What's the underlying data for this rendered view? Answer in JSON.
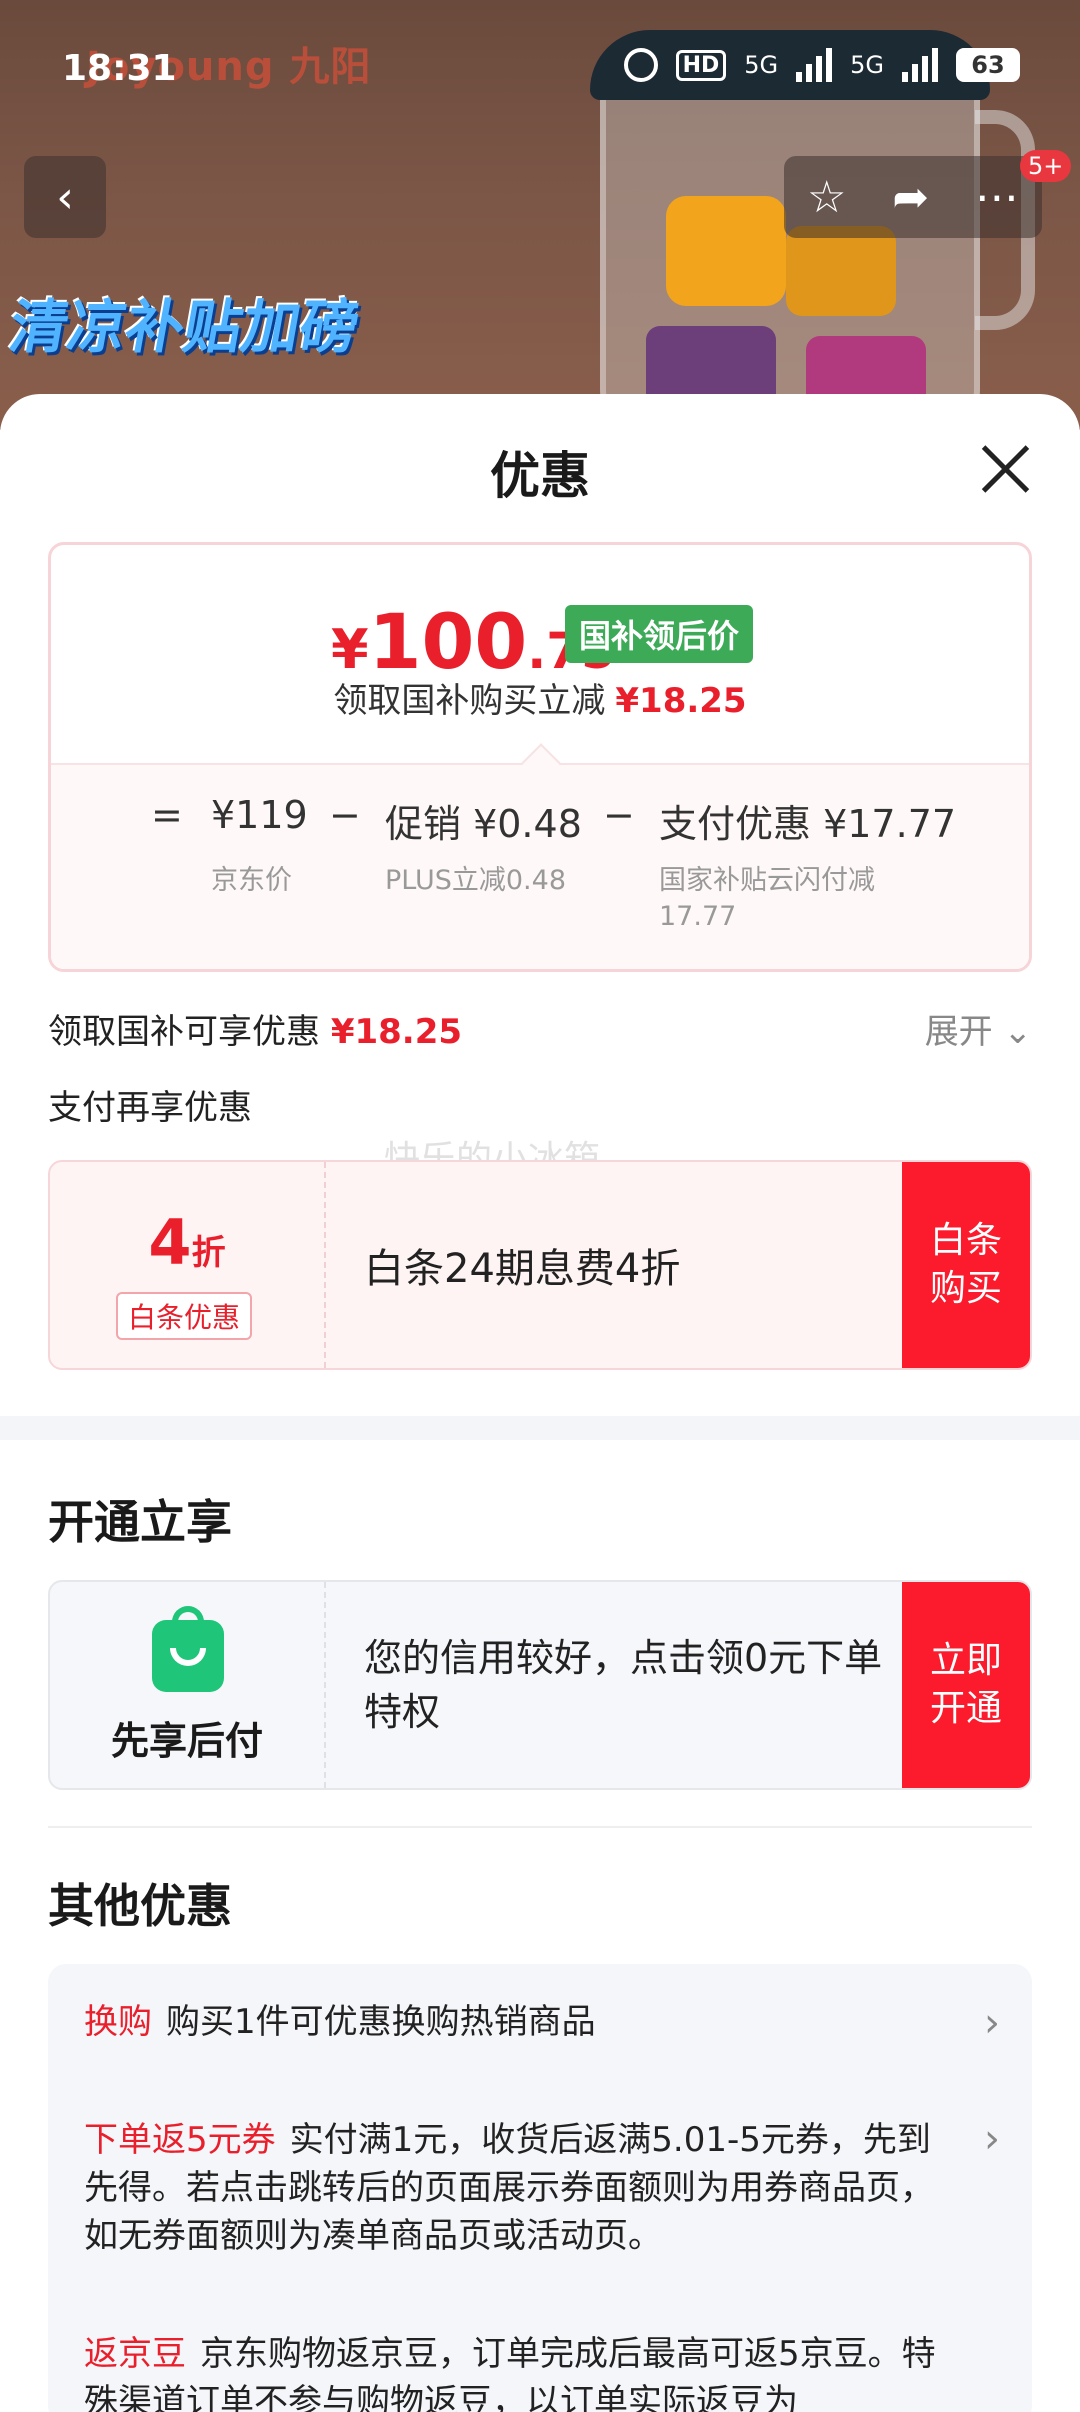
{
  "status_bar": {
    "time": "18:31",
    "battery": "63",
    "net1": "5G",
    "net2": "5G",
    "hd": "HD"
  },
  "background": {
    "brand": "Joyoung 九阳",
    "promo_text": "清凉补贴加磅"
  },
  "nav": {
    "badge": "5+"
  },
  "sheet": {
    "title": "优惠"
  },
  "price_card": {
    "yen": "¥",
    "price_int": "100",
    "price_dec": ".75",
    "tag": "国补领后价",
    "subtitle": "领取国补购买立减",
    "subtitle_amount": "¥18.25",
    "eq": "=",
    "jd_price": "¥119",
    "jd_label": "京东价",
    "minus1": "−",
    "promo": "促销 ¥0.48",
    "promo_label": "PLUS立减0.48",
    "minus2": "−",
    "pay": "支付优惠 ¥17.77",
    "pay_label": "国家补贴云闪付减17.77"
  },
  "national": {
    "text": "领取国补可享优惠",
    "amount": "¥18.25",
    "expand": "展开"
  },
  "pay_more": {
    "title": "支付再享优惠"
  },
  "baitiao": {
    "discount": "4",
    "unit": "折",
    "tag": "白条优惠",
    "desc": "白条24期息费4折",
    "button": "白条购买"
  },
  "open_section": {
    "title": "开通立享",
    "logo_label": "先享后付",
    "desc": "您的信用较好，点击领0元下单特权",
    "button": "立即开通"
  },
  "other": {
    "title": "其他优惠",
    "items": [
      {
        "tag": "换购",
        "text": "购买1件可优惠换购热销商品"
      },
      {
        "tag": "下单返5元券",
        "text": "实付满1元，收货后返满5.01-5元券，先到先得。若点击跳转后的页面展示券面额则为用券商品页，如无券面额则为凑单商品页或活动页。"
      },
      {
        "tag": "返京豆",
        "text": "京东购物返京豆，订单完成后最高可返5京豆。特殊渠道订单不参与购物返豆，以订单实际返豆为"
      }
    ]
  },
  "watermark": "快乐的小冰箱",
  "colors": {
    "accent_red": "#e9202c",
    "button_red": "#fb1b2d",
    "green_tag": "#3daa57"
  }
}
